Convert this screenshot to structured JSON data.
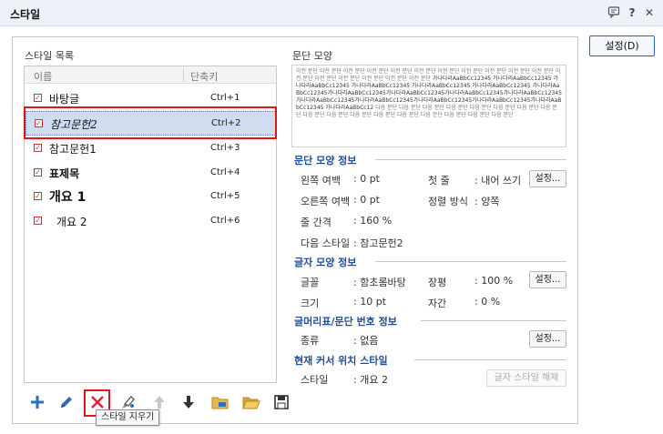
{
  "window": {
    "title": "스타일",
    "help_glyph": "?",
    "close_glyph": "✕"
  },
  "settings_button": "설정(D)",
  "style_list": {
    "label": "스타일 목록",
    "col_name": "이름",
    "col_shortcut": "단축키",
    "items": [
      {
        "name": "바탕글",
        "shortcut": "Ctrl+1"
      },
      {
        "name": "참고문헌2",
        "shortcut": "Ctrl+2"
      },
      {
        "name": "참고문헌1",
        "shortcut": "Ctrl+3"
      },
      {
        "name": "표제목",
        "shortcut": "Ctrl+4"
      },
      {
        "name": "개요 1",
        "shortcut": "Ctrl+5"
      },
      {
        "name": "개요 2",
        "shortcut": "Ctrl+6"
      }
    ]
  },
  "preview": {
    "label": "문단 모양",
    "before_text": "이전 문단 이전 문단 이전 문단 이전 문단 이전 문단 이전 문단 이전 문단 이전 문단 이전 문단 이전 문단 이전 문단 이전 문단 이전 문단 이전 문단 이전 문단 이전 문단 이전 문단",
    "sample_text": "가나다라AaBbCc12345 가나다라AaBbCc12345 가나다라AaBbCc12345 가나다라AaBbCc12345 가나다라AaBbCc12345 가나다라AaBbCc12345 가나다라AaBbCc12345가나다라AaBbCc12345가나다라AaBbCc12345가나다라AaBbCc12345가나다라AaBbCc12345가나다라AaBbCc12345가나다라AaBbCc12345가나다라AaBbCc12345가나다라AaBbCc12345가나다라AaBbCc12345 가나다라AaBbCc12",
    "after_text": "다음 문단 다음 문단 다음 문단 다음 문단 다음 문단 다음 문단 다음 문단 다음 문단 다음 문단 다음 문단 다음 문단 다음 문단 다음 문단 다음 문단 다음 문단 다음 문단 다음 문단"
  },
  "para_info": {
    "title": "문단 모양 정보",
    "left_margin_label": "왼쪽 여백",
    "left_margin_value": ": 0 pt",
    "first_line_label": "첫 줄",
    "first_line_value": ": 내어 쓰기",
    "right_margin_label": "오른쪽 여백",
    "right_margin_value": ": 0 pt",
    "align_label": "정렬 방식",
    "align_value": ": 양쪽",
    "line_spacing_label": "줄 간격",
    "line_spacing_value": ": 160 %",
    "next_style_label": "다음 스타일",
    "next_style_value": ": 참고문헌2",
    "settings": "설정..."
  },
  "char_info": {
    "title": "글자 모양 정보",
    "font_label": "글꼴",
    "font_value": ": 함초롬바탕",
    "width_label": "장평",
    "width_value": ": 100 %",
    "size_label": "크기",
    "size_value": ": 10 pt",
    "spacing_label": "자간",
    "spacing_value": ": 0 %",
    "settings": "설정..."
  },
  "bullet_info": {
    "title": "글머리표/문단 번호 정보",
    "kind_label": "종류",
    "kind_value": ": 없음",
    "settings": "설정..."
  },
  "cursor_style": {
    "title": "현재 커서 위치 스타일",
    "style_label": "스타일",
    "style_value": ": 개요 2",
    "release_button": "글자 스타일 해제"
  },
  "tooltip": "스타일 지우기",
  "icons": {
    "add": "plus-icon",
    "edit": "pencil-icon",
    "delete": "x-icon",
    "replace": "brush-icon",
    "up": "arrow-up-icon",
    "down": "arrow-down-icon",
    "import": "folder-import-icon",
    "open": "folder-open-icon",
    "save": "floppy-icon"
  }
}
